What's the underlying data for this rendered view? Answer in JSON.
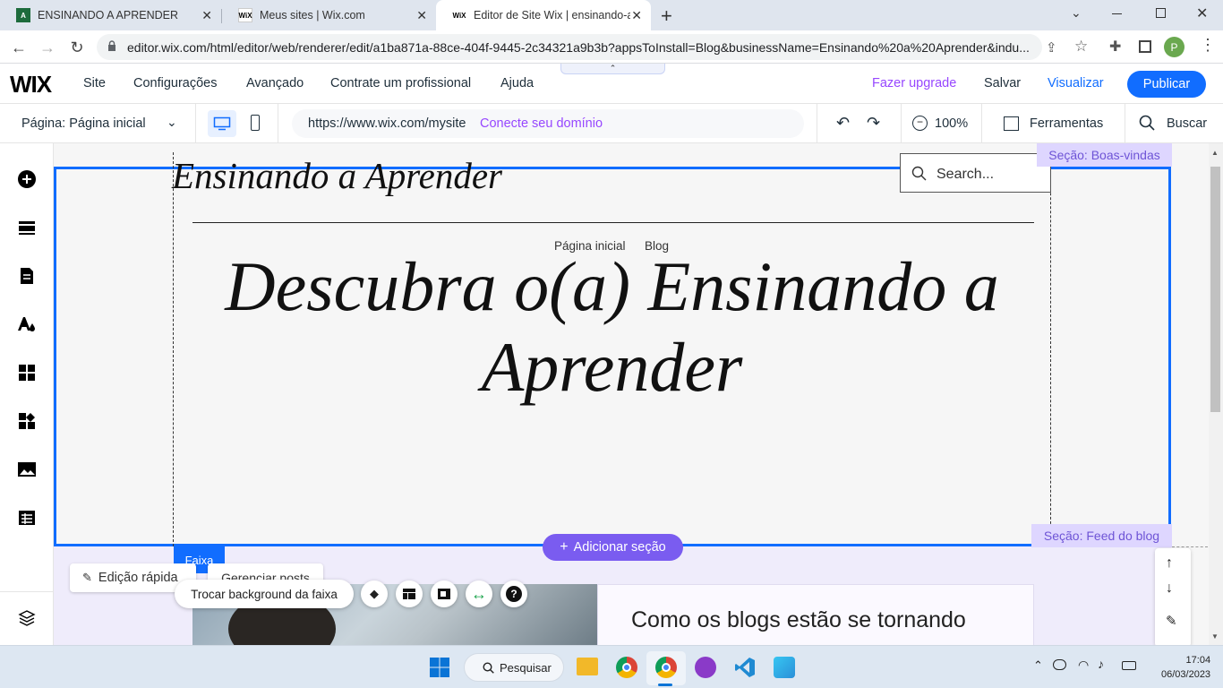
{
  "browser": {
    "tabs": [
      {
        "title": "ENSINANDO A APRENDER",
        "active": false
      },
      {
        "title": "Meus sites | Wix.com",
        "active": false
      },
      {
        "title": "Editor de Site Wix | ensinando-a-",
        "active": true
      }
    ],
    "url": "editor.wix.com/html/editor/web/renderer/edit/a1ba871a-88ce-404f-9445-2c34321a9b3b?appsToInstall=Blog&businessName=Ensinando%20a%20Aprender&indu...",
    "profile_initial": "P"
  },
  "wix": {
    "logo": "WIX",
    "menu": [
      "Site",
      "Configurações",
      "Avançado",
      "Contrate um profissional",
      "Ajuda"
    ],
    "upgrade": "Fazer upgrade",
    "save": "Salvar",
    "preview": "Visualizar",
    "publish": "Publicar",
    "page_selector": "Página: Página inicial",
    "site_url": "https://www.wix.com/mysite",
    "connect_domain": "Conecte seu domínio",
    "zoom": "100%",
    "tools": "Ferramentas",
    "search": "Buscar"
  },
  "canvas": {
    "site_title": "Ensinando a Aprender",
    "search_placeholder": "Search...",
    "nav": [
      "Página inicial",
      "Blog"
    ],
    "hero_line1": "Descubra o(a) Ensinando a",
    "hero_line2": "Aprender",
    "section_label_1": "Seção: Boas-vindas",
    "section_label_2": "Seção: Feed do blog",
    "add_section": "Adicionar seção",
    "strip_tag": "Faixa",
    "quick_edit": "Edição rápida",
    "manage_posts": "Gerenciar posts",
    "change_bg": "Trocar background da faixa",
    "post_title": "Como os blogs estão se tornando"
  },
  "taskbar": {
    "search": "Pesquisar",
    "time": "17:04",
    "date": "06/03/2023"
  },
  "colors": {
    "wix_blue": "#116dff",
    "purple": "#9747ff",
    "section_label_bg": "#ded6ff",
    "add_section_bg": "#7a5cf0"
  }
}
